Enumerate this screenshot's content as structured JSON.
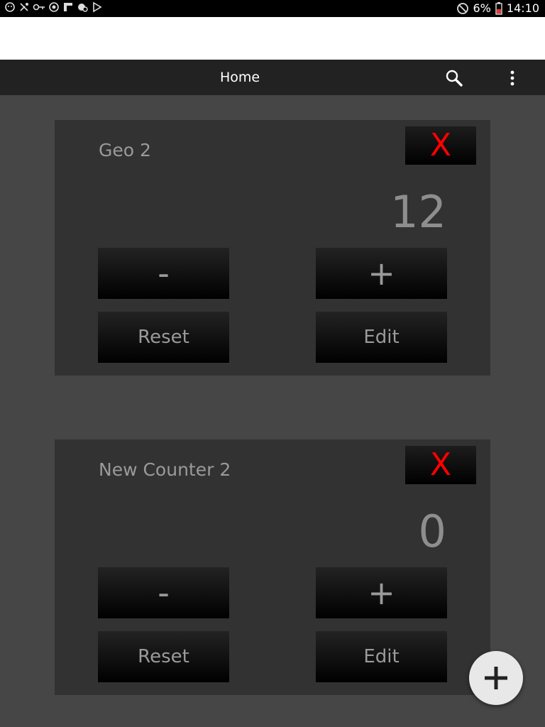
{
  "status_bar": {
    "battery": "6%",
    "time": "14:10"
  },
  "app_bar": {
    "title": "Home",
    "search_icon": "search-icon",
    "menu_icon": "overflow-menu-icon"
  },
  "counters": [
    {
      "name": "Geo 2",
      "count": "12",
      "close_label": "X",
      "decrement_label": "-",
      "increment_label": "+",
      "reset_label": "Reset",
      "edit_label": "Edit"
    },
    {
      "name": "New Counter 2",
      "count": "0",
      "close_label": "X",
      "decrement_label": "-",
      "increment_label": "+",
      "reset_label": "Reset",
      "edit_label": "Edit"
    }
  ],
  "fab": {
    "icon": "plus-icon"
  },
  "colors": {
    "background": "#464646",
    "card": "#323232",
    "app_bar": "#222222",
    "close_accent": "#ff0000",
    "fab": "#e8e8e8"
  }
}
